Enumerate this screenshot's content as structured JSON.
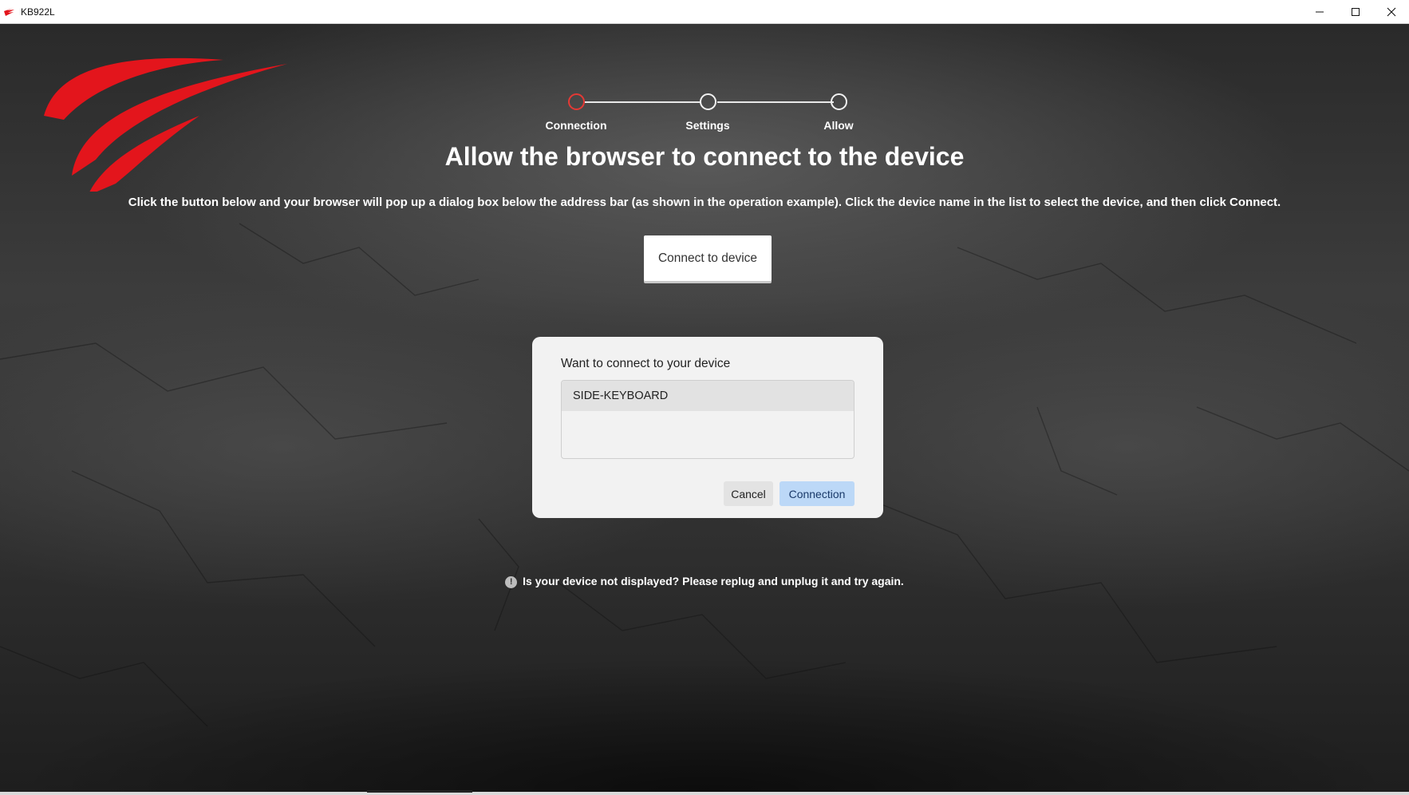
{
  "window": {
    "title": "KB922L",
    "controls": {
      "minimize_icon": "minimize-icon",
      "maximize_icon": "maximize-icon",
      "close_icon": "close-icon"
    }
  },
  "stepper": {
    "steps": [
      {
        "label": "Connection",
        "active": true
      },
      {
        "label": "Settings",
        "active": false
      },
      {
        "label": "Allow",
        "active": false
      }
    ],
    "active_color": "#e53935"
  },
  "main": {
    "heading": "Allow the browser to connect to the device",
    "description": "Click the button below and your browser will pop up a dialog box below the address bar (as shown in the operation example). Click the device name in the list to select the device, and then click Connect.",
    "connect_button": "Connect to device"
  },
  "dialog": {
    "title": "Want to connect to your device",
    "devices": [
      "SIDE-KEYBOARD"
    ],
    "cancel_label": "Cancel",
    "connect_label": "Connection"
  },
  "hint": {
    "icon": "info-icon",
    "text": "Is your device not displayed? Please replug and unplug it and try again."
  },
  "colors": {
    "brand_red": "#e3151c",
    "dialog_primary": "#bcd8f7"
  }
}
